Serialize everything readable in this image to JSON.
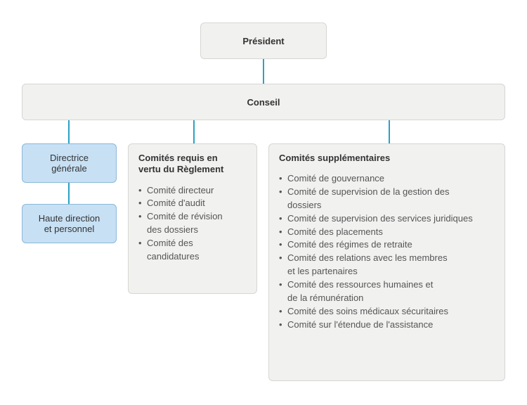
{
  "nodes": {
    "president": "Président",
    "conseil": "Conseil",
    "directrice": "Directrice\ngénérale",
    "haute_direction": "Haute direction\net personnel"
  },
  "panel_required": {
    "title": "Comités requis en\nvertu du Règlement",
    "items": [
      "Comité directeur",
      "Comité d'audit",
      "Comité de révision\ndes dossiers",
      "Comité des\ncandidatures"
    ]
  },
  "panel_supplementary": {
    "title": "Comités supplémentaires",
    "items": [
      "Comité de gouvernance",
      "Comité de supervision de la gestion des\ndossiers",
      "Comité de supervision des services juridiques",
      "Comité des placements",
      "Comité des régimes de retraite",
      "Comité des relations avec les membres\net les partenaires",
      "Comité des ressources humaines et\nde la rémunération",
      "Comité des soins médicaux sécuritaires",
      "Comité sur l'étendue de l'assistance"
    ]
  }
}
